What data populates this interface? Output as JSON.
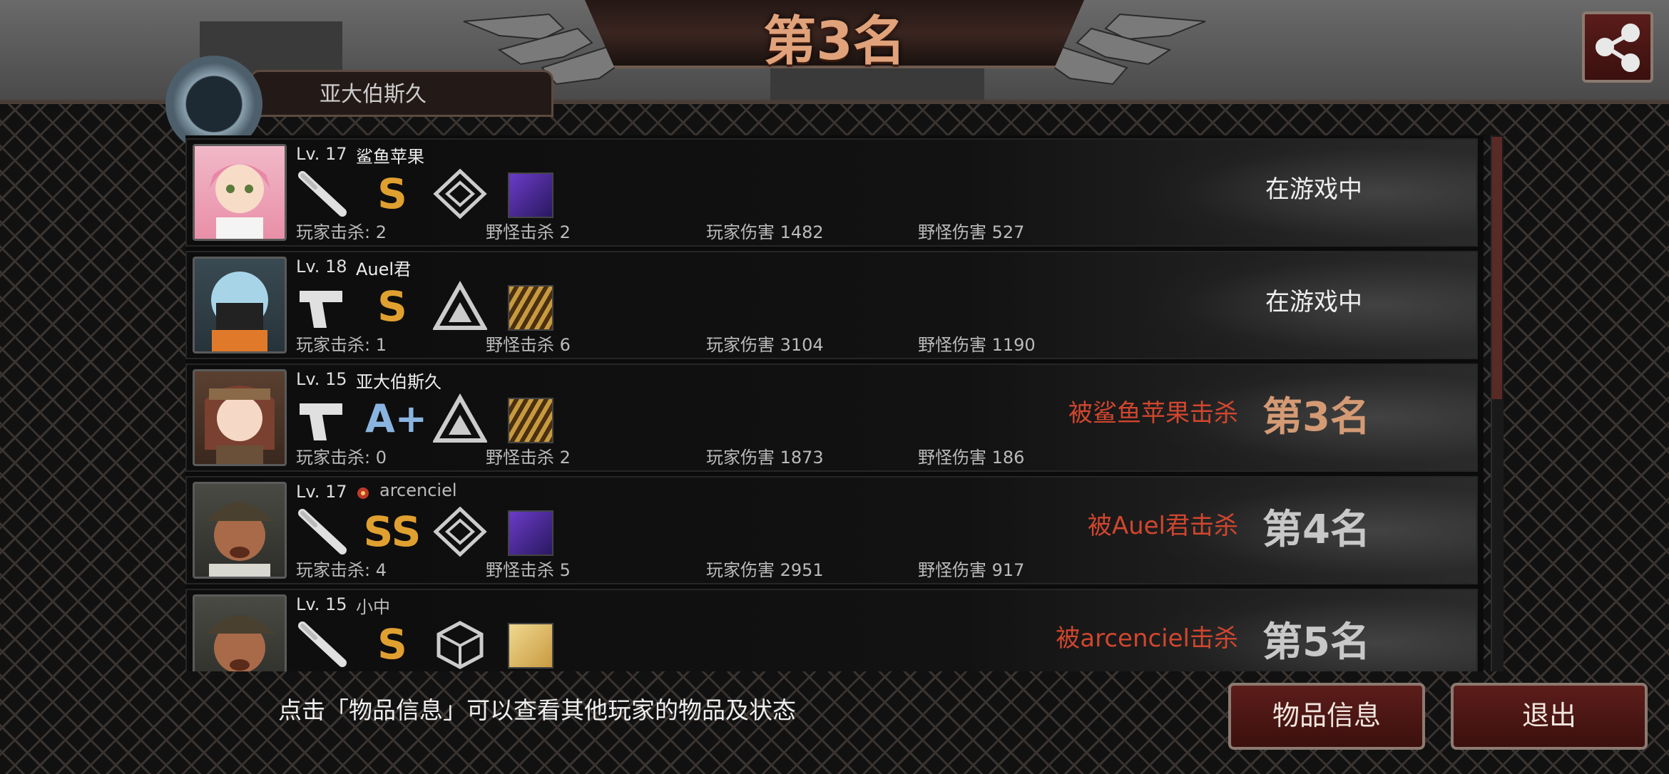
{
  "header": {
    "rank_title": "第3名",
    "tab_label": "亚大伯斯久"
  },
  "players": [
    {
      "level": "Lv. 17",
      "name": "鲨鱼苹果",
      "weapon_icon": "baseball-bat-icon",
      "grade": "S",
      "emblem_icon": "diamond-emblem-icon",
      "skill_icon": "purple-skill-icon",
      "stats": [
        "玩家击杀: 2",
        "野怪击杀 2",
        "玩家伤害 1482",
        "野怪伤害 527"
      ],
      "status": "在游戏中",
      "killed_by": "",
      "place": ""
    },
    {
      "level": "Lv. 18",
      "name": "Auel君",
      "weapon_icon": "pistol-icon",
      "grade": "S",
      "emblem_icon": "triangle-emblem-icon",
      "skill_icon": "bullets-skill-icon",
      "stats": [
        "玩家击杀: 1",
        "野怪击杀 6",
        "玩家伤害 3104",
        "野怪伤害 1190"
      ],
      "status": "在游戏中",
      "killed_by": "",
      "place": ""
    },
    {
      "level": "Lv. 15",
      "name": "亚大伯斯久",
      "weapon_icon": "pistol-icon",
      "grade": "A+",
      "emblem_icon": "triangle-emblem-icon",
      "skill_icon": "bullets-skill-icon",
      "stats": [
        "玩家击杀: 0",
        "野怪击杀 2",
        "玩家伤害 1873",
        "野怪伤害 186"
      ],
      "status": "",
      "killed_by": "被鲨鱼苹果击杀",
      "place": "第3名"
    },
    {
      "level": "Lv. 17",
      "name": "arcenciel",
      "weapon_icon": "baseball-bat-icon",
      "grade": "SS",
      "emblem_icon": "diamond-emblem-icon",
      "skill_icon": "purple-skill-icon",
      "stats": [
        "玩家击杀: 4",
        "野怪击杀 5",
        "玩家伤害 2951",
        "野怪伤害 917"
      ],
      "status": "",
      "killed_by": "被Auel君击杀",
      "place": "第4名"
    },
    {
      "level": "Lv. 15",
      "name": "小中",
      "weapon_icon": "baseball-bat-icon",
      "grade": "S",
      "emblem_icon": "cube-emblem-icon",
      "skill_icon": "gold-skill-icon",
      "stats": [],
      "status": "",
      "killed_by": "被arcenciel击杀",
      "place": "第5名"
    }
  ],
  "footer": {
    "hint": "点击「物品信息」可以查看其他玩家的物品及状态",
    "items_button": "物品信息",
    "exit_button": "退出"
  },
  "colors": {
    "accent_copper": "#d49a74",
    "kill_red": "#d0462e",
    "button_red": "#5c1d1a"
  }
}
